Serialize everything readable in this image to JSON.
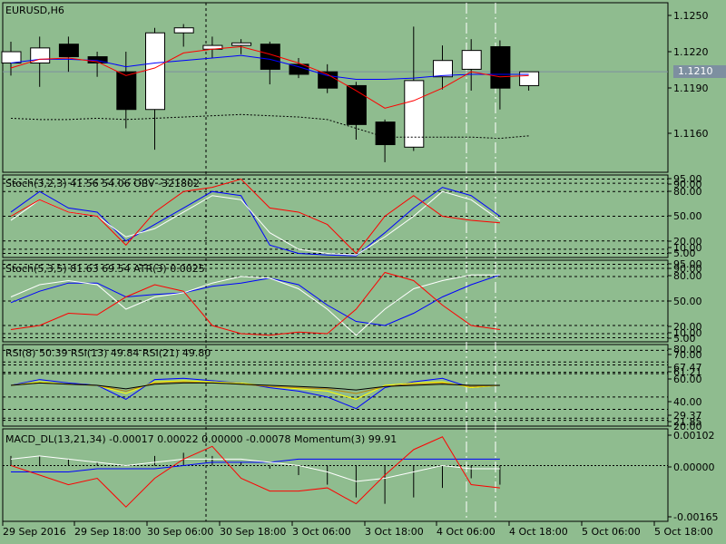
{
  "symbol_title": "EURUSD,H6",
  "price_tag": "1.1210",
  "colors": {
    "bg": "#8fbc8f",
    "bull": "#ffffff",
    "bear": "#000000",
    "blue": "#0000ff",
    "red": "#ff0000",
    "white": "#ffffff",
    "yellow": "#ffff00",
    "gold": "#b8860b",
    "aqua": "#00ffff"
  },
  "x_labels": [
    "29 Sep 2016",
    "29 Sep 18:00",
    "30 Sep 06:00",
    "30 Sep 18:00",
    "3 Oct 06:00",
    "3 Oct 18:00",
    "4 Oct 06:00",
    "4 Oct 18:00",
    "5 Oct 06:00",
    "5 Oct 18:00"
  ],
  "panels": {
    "price": {
      "y_ticks": [
        "1.1250",
        "1.1220",
        "1.1190",
        "1.1160"
      ]
    },
    "stoch1": {
      "title": "Stoch(3,2,3) 41.56 54.06 OBV -321802",
      "y_ticks": [
        "95.00",
        "90.00",
        "80.00",
        "50.00",
        "20.00",
        "10.00",
        "5.00"
      ]
    },
    "stoch2": {
      "title": "Stoch(5,3,5) 81.63 69.54 ATR(3) 0.0025",
      "y_ticks": [
        "95.00",
        "90.00",
        "80.00",
        "50.00",
        "20.00",
        "10.00",
        "5.00"
      ]
    },
    "rsi": {
      "title": "RSI(8) 50.39 RSI(13) 49.84 RSI(21) 49.80",
      "y_ticks": [
        "80.00",
        "70.00",
        "67.47",
        "61.21",
        "60.00",
        "40.00",
        "29.37",
        "21.85",
        "20.00"
      ]
    },
    "macd": {
      "title": "MACD_DL(13,21,34) -0.00017 0.00022 0.00000 -0.00078 Momentum(3) 99.91",
      "y_ticks": [
        "0.00102",
        "0.00000",
        "-0.00165"
      ]
    }
  },
  "chart_data": [
    {
      "type": "candlestick",
      "title": "EURUSD,H6",
      "ylim": [
        1.113,
        1.1265
      ],
      "current_price": 1.121,
      "candles": [
        {
          "o": 1.1217,
          "h": 1.1234,
          "l": 1.1207,
          "c": 1.1226
        },
        {
          "o": 1.1217,
          "h": 1.1238,
          "l": 1.1198,
          "c": 1.1229
        },
        {
          "o": 1.1232,
          "h": 1.1238,
          "l": 1.121,
          "c": 1.1222
        },
        {
          "o": 1.1222,
          "h": 1.1226,
          "l": 1.1206,
          "c": 1.1217
        },
        {
          "o": 1.121,
          "h": 1.1226,
          "l": 1.1165,
          "c": 1.118
        },
        {
          "o": 1.118,
          "h": 1.1245,
          "l": 1.1148,
          "c": 1.1241
        },
        {
          "o": 1.1241,
          "h": 1.1248,
          "l": 1.123,
          "c": 1.1245
        },
        {
          "o": 1.1228,
          "h": 1.1238,
          "l": 1.1221,
          "c": 1.1231
        },
        {
          "o": 1.1231,
          "h": 1.1236,
          "l": 1.1224,
          "c": 1.1233
        },
        {
          "o": 1.1232,
          "h": 1.1234,
          "l": 1.12,
          "c": 1.1212
        },
        {
          "o": 1.1216,
          "h": 1.1221,
          "l": 1.1205,
          "c": 1.1208
        },
        {
          "o": 1.121,
          "h": 1.1216,
          "l": 1.1193,
          "c": 1.1197
        },
        {
          "o": 1.1199,
          "h": 1.1202,
          "l": 1.1156,
          "c": 1.1168
        },
        {
          "o": 1.117,
          "h": 1.1172,
          "l": 1.1138,
          "c": 1.1152
        },
        {
          "o": 1.115,
          "h": 1.1246,
          "l": 1.1147,
          "c": 1.1203
        },
        {
          "o": 1.1206,
          "h": 1.1231,
          "l": 1.1196,
          "c": 1.1219
        },
        {
          "o": 1.1212,
          "h": 1.1236,
          "l": 1.1195,
          "c": 1.1227
        },
        {
          "o": 1.123,
          "h": 1.1235,
          "l": 1.118,
          "c": 1.1197
        },
        {
          "o": 1.1199,
          "h": 1.121,
          "l": 1.1195,
          "c": 1.121
        }
      ],
      "series": [
        {
          "values": [
            1.1217,
            1.122,
            1.122,
            1.1219,
            1.1214,
            1.1217,
            1.1219,
            1.1221,
            1.1223,
            1.122,
            1.1214,
            1.1207,
            1.1204,
            1.1204,
            1.1205,
            1.1207,
            1.1208,
            1.1208,
            1.1208
          ]
        },
        {
          "values": [
            1.1213,
            1.122,
            1.1221,
            1.1218,
            1.1207,
            1.1213,
            1.1225,
            1.1228,
            1.123,
            1.1224,
            1.1217,
            1.1208,
            1.1195,
            1.1181,
            1.1187,
            1.1197,
            1.121,
            1.1206,
            1.1207
          ]
        },
        {
          "values": [
            1.1173,
            1.1172,
            1.1172,
            1.1173,
            1.1172,
            1.1173,
            1.1174,
            1.1175,
            1.1176,
            1.1175,
            1.1174,
            1.1172,
            1.1165,
            1.1158,
            1.1158,
            1.1158,
            1.1158,
            1.1157,
            1.1159
          ]
        }
      ]
    },
    {
      "type": "line",
      "title": "Stoch(3,2,3) 41.56 54.06 OBV -321802",
      "ylim": [
        0,
        100
      ],
      "levels": [
        95,
        90,
        80,
        50,
        20,
        10,
        5
      ],
      "series": [
        {
          "values": [
            55,
            80,
            60,
            55,
            20,
            40,
            60,
            80,
            75,
            15,
            5,
            3,
            2,
            30,
            60,
            85,
            75,
            50
          ]
        },
        {
          "values": [
            45,
            70,
            55,
            50,
            25,
            35,
            55,
            75,
            70,
            30,
            10,
            5,
            3,
            25,
            50,
            80,
            70,
            45
          ]
        },
        {
          "values": [
            50,
            70,
            55,
            50,
            15,
            55,
            80,
            85,
            95,
            60,
            55,
            40,
            5,
            50,
            75,
            50,
            45,
            42
          ]
        }
      ]
    },
    {
      "type": "line",
      "title": "Stoch(5,3,5) 81.63 69.54 ATR(3) 0.0025",
      "ylim": [
        0,
        100
      ],
      "levels": [
        95,
        90,
        80,
        50,
        20,
        10,
        5
      ],
      "series": [
        {
          "values": [
            48,
            62,
            72,
            72,
            55,
            58,
            60,
            68,
            72,
            78,
            70,
            45,
            25,
            20,
            35,
            55,
            70,
            82
          ]
        },
        {
          "values": [
            55,
            70,
            75,
            70,
            40,
            55,
            60,
            72,
            80,
            78,
            65,
            40,
            8,
            40,
            65,
            75,
            82,
            82
          ]
        },
        {
          "values": [
            15,
            20,
            35,
            33,
            55,
            70,
            62,
            20,
            10,
            8,
            12,
            10,
            40,
            85,
            75,
            45,
            20,
            15
          ]
        }
      ]
    },
    {
      "type": "line",
      "title": "RSI(8) 50.39 RSI(13) 49.84 RSI(21) 49.80",
      "ylim": [
        15,
        85
      ],
      "levels": [
        80,
        70,
        67.47,
        61.21,
        60,
        40,
        29.37,
        21.85,
        20
      ],
      "series": [
        {
          "values": [
            50,
            55,
            52,
            50,
            38,
            55,
            56,
            54,
            52,
            48,
            45,
            40,
            30,
            48,
            53,
            56,
            48,
            50
          ]
        },
        {
          "values": [
            50,
            53,
            51,
            50,
            43,
            53,
            54,
            53,
            52,
            49,
            47,
            45,
            38,
            50,
            52,
            53,
            48,
            50
          ]
        },
        {
          "values": [
            50,
            52,
            51,
            50,
            45,
            52,
            53,
            52,
            51,
            49,
            48,
            47,
            43,
            49,
            51,
            52,
            49,
            50
          ]
        },
        {
          "values": [
            50,
            52,
            51,
            50,
            47,
            51,
            52,
            52,
            51,
            50,
            49,
            48,
            46,
            49,
            50,
            51,
            50,
            50
          ]
        }
      ]
    },
    {
      "type": "bar_line",
      "title": "MACD_DL(13,21,34) -0.00017 0.00022 0.00000 -0.00078 Momentum(3) 99.91",
      "ylim": [
        -0.00175,
        0.00115
      ],
      "histogram": [
        0.0003,
        0.0003,
        0.0002,
        0.0001,
        0.0,
        0.0003,
        0.0004,
        0.0003,
        0.0001,
        -0.0001,
        -0.0003,
        -0.0006,
        -0.001,
        -0.0012,
        -0.001,
        -0.0007,
        -0.0004,
        -0.0006
      ],
      "series": [
        {
          "values": [
            -0.0002,
            -0.0002,
            -0.0002,
            -0.0001,
            -0.0001,
            -0.0001,
            0.0,
            0.0001,
            0.0001,
            0.0001,
            0.0002,
            0.0002,
            0.0002,
            0.0002,
            0.0002,
            0.0002,
            0.0002,
            0.0002
          ]
        },
        {
          "values": [
            0.0002,
            0.0003,
            0.0002,
            0.0001,
            0.0,
            0.0001,
            0.0002,
            0.0002,
            0.0002,
            0.0001,
            0.0,
            -0.0002,
            -0.0005,
            -0.0004,
            -0.0002,
            0.0,
            -0.0001,
            -0.0001
          ]
        },
        {
          "values": [
            0.0,
            -0.0003,
            -0.0006,
            -0.0004,
            -0.0013,
            -0.0004,
            0.0002,
            0.0006,
            -0.0004,
            -0.0008,
            -0.0008,
            -0.0007,
            -0.0012,
            -0.0003,
            0.0005,
            0.0009,
            -0.0006,
            -0.0007
          ]
        }
      ]
    }
  ]
}
